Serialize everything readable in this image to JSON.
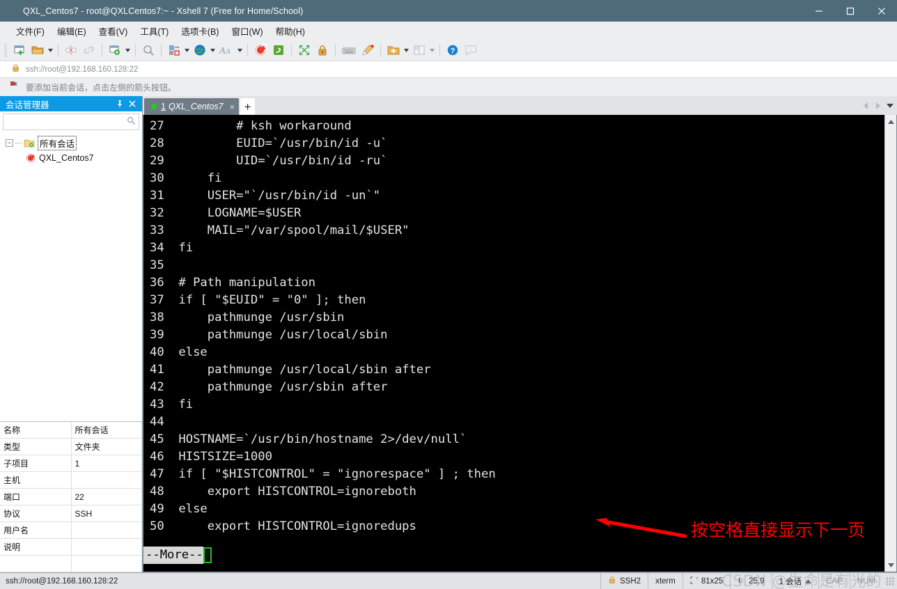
{
  "window": {
    "title": "QXL_Centos7 - root@QXLCentos7:~ - Xshell 7 (Free for Home/School)",
    "app_icon": "xshell-spiral-icon",
    "minimize_label": "—",
    "maximize_label": "□",
    "close_label": "✕",
    "accent_title_bg": "#4f6b7a"
  },
  "menubar": {
    "items": [
      {
        "label": "文件(F)",
        "name": "menu-file"
      },
      {
        "label": "编辑(E)",
        "name": "menu-edit"
      },
      {
        "label": "查看(V)",
        "name": "menu-view"
      },
      {
        "label": "工具(T)",
        "name": "menu-tools"
      },
      {
        "label": "选项卡(B)",
        "name": "menu-tabs"
      },
      {
        "label": "窗口(W)",
        "name": "menu-window"
      },
      {
        "label": "帮助(H)",
        "name": "menu-help"
      }
    ]
  },
  "toolbar": {
    "icons": [
      "new-session-icon",
      "open-folder-icon",
      "disconnect-icon",
      "reconnect-icon",
      "session-properties-icon",
      "find-icon",
      "transfer-icon",
      "globe-icon",
      "font-icon",
      "xshell-icon",
      "xftp-icon",
      "fullscreen-icon",
      "lock-icon",
      "keyboard-icon",
      "highlight-icon",
      "new-folder-icon",
      "layout-icon",
      "help-icon",
      "comment-icon"
    ]
  },
  "addressbar": {
    "lock_icon": "lock-icon",
    "url": "ssh://root@192.168.160.128:22"
  },
  "notice": {
    "icon": "red-flag-icon",
    "text": "要添加当前会话，点击左侧的箭头按钮。"
  },
  "session_panel": {
    "title": "会话管理器",
    "pin_icon": "pin-icon",
    "close_icon": "close-icon",
    "search": {
      "value": "",
      "placeholder": "",
      "icon": "search-icon"
    },
    "tree": {
      "root": {
        "label": "所有会话",
        "icon": "folder-icon",
        "expander": "−",
        "selected": true
      },
      "children": [
        {
          "label": "QXL_Centos7",
          "icon": "xshell-session-icon"
        }
      ]
    },
    "properties": {
      "rows": [
        {
          "key": "名称",
          "value": "所有会话"
        },
        {
          "key": "类型",
          "value": "文件夹"
        },
        {
          "key": "子项目",
          "value": "1"
        },
        {
          "key": "主机",
          "value": ""
        },
        {
          "key": "端口",
          "value": "22"
        },
        {
          "key": "协议",
          "value": "SSH"
        },
        {
          "key": "用户名",
          "value": ""
        },
        {
          "key": "说明",
          "value": ""
        }
      ]
    }
  },
  "tabbar": {
    "tabs": [
      {
        "number": "1",
        "label": "QXL_Centos7",
        "status_color": "#19d219",
        "close_label": "×",
        "active": true
      }
    ],
    "add_label": "+",
    "nav_prev_icon": "chevron-left-icon",
    "nav_next_icon": "chevron-right-icon",
    "nav_menu_icon": "chevron-down-icon"
  },
  "terminal": {
    "background": "#000000",
    "foreground": "#e4e4e4",
    "lines": [
      {
        "num": "27",
        "text": "        # ksh workaround"
      },
      {
        "num": "28",
        "text": "        EUID=`/usr/bin/id -u`"
      },
      {
        "num": "29",
        "text": "        UID=`/usr/bin/id -ru`"
      },
      {
        "num": "30",
        "text": "    fi"
      },
      {
        "num": "31",
        "text": "    USER=\"`/usr/bin/id -un`\""
      },
      {
        "num": "32",
        "text": "    LOGNAME=$USER"
      },
      {
        "num": "33",
        "text": "    MAIL=\"/var/spool/mail/$USER\""
      },
      {
        "num": "34",
        "text": "fi"
      },
      {
        "num": "35",
        "text": ""
      },
      {
        "num": "36",
        "text": "# Path manipulation"
      },
      {
        "num": "37",
        "text": "if [ \"$EUID\" = \"0\" ]; then"
      },
      {
        "num": "38",
        "text": "    pathmunge /usr/sbin"
      },
      {
        "num": "39",
        "text": "    pathmunge /usr/local/sbin"
      },
      {
        "num": "40",
        "text": "else"
      },
      {
        "num": "41",
        "text": "    pathmunge /usr/local/sbin after"
      },
      {
        "num": "42",
        "text": "    pathmunge /usr/sbin after"
      },
      {
        "num": "43",
        "text": "fi"
      },
      {
        "num": "44",
        "text": ""
      },
      {
        "num": "45",
        "text": "HOSTNAME=`/usr/bin/hostname 2>/dev/null`"
      },
      {
        "num": "46",
        "text": "HISTSIZE=1000"
      },
      {
        "num": "47",
        "text": "if [ \"$HISTCONTROL\" = \"ignorespace\" ] ; then"
      },
      {
        "num": "48",
        "text": "    export HISTCONTROL=ignoreboth"
      },
      {
        "num": "49",
        "text": "else"
      },
      {
        "num": "50",
        "text": "    export HISTCONTROL=ignoredups"
      }
    ],
    "pager_prompt": "--More--",
    "cursor_color": "#16c416"
  },
  "annotation": {
    "text": "按空格直接显示下一页",
    "color": "#ff0000",
    "arrow_icon": "left-arrow-icon"
  },
  "statusbar": {
    "connection": "ssh://root@192.168.160.128:22",
    "protocol": "SSH2",
    "protocol_icon": "lock-icon",
    "terminal_type": "xterm",
    "size": "81x25",
    "size_icon": "size-icon",
    "cursor_position": "25,9",
    "cursor_icon": "cursor-icon",
    "session_count": "1 会话",
    "caps": "CAP",
    "num": "NUM"
  },
  "watermark": {
    "text": "CSDN @生命是有光的"
  }
}
